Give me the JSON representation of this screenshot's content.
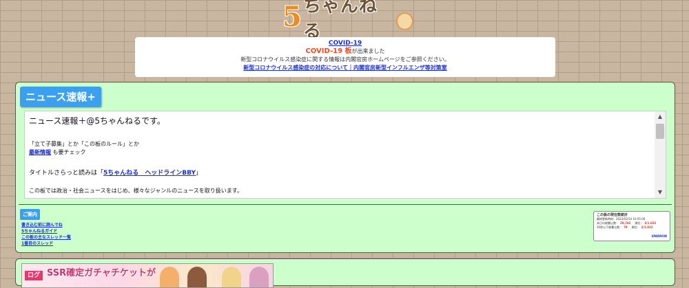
{
  "site": {
    "logo_five": "5",
    "logo_text": "ちゃんねる"
  },
  "notice": {
    "title_link": "COVID-19",
    "head_board": "COVID-19 板",
    "head_suffix": "が出来ました",
    "description": "新型コロナウイルス感染症に関する情報は内閣官房ホームページをご参照ください。",
    "link": "新型コロナウイルス感染症の対応について｜内閣官房新型インフルエンザ等対策室"
  },
  "board": {
    "title": "ニュース速報+",
    "desc_heading": "ニュース速報＋@5ちゃんねるです。",
    "desc_line1": "「立て子募集」とか「この板のルール」とか",
    "desc_link_latest": "最新情報",
    "desc_line2_suffix": "も要チェック",
    "desc_headline_prefix": "タイトルさらっと読みは「",
    "desc_headline_link": "5ちゃんねる　ヘッドラインBBY",
    "desc_headline_suffix": "」",
    "desc_line4": "この板では政治・社会ニュースをはじめ、様々なジャンルのニュースを取り扱います。"
  },
  "guide": {
    "label": "ご案内",
    "links": [
      "書き込む前に読んでね",
      "5ちゃんねるガイド",
      "この板の主なスレッド一覧",
      "1番目のスレッド"
    ]
  },
  "stats": {
    "title": "この板の現在数統計",
    "updated": "最終更新時刻：2023/03/14 10:05:00",
    "row1_label": "本日の総書込数：",
    "row1_value": "29,742",
    "row1_label2": "順位：",
    "row1_value2": "3/1,032",
    "row2_label": "30秒以下総書込数：",
    "row2_value": "79",
    "row2_label2": "順位：",
    "row2_value2": "2/1,032",
    "link": "SPARROW"
  },
  "ad": {
    "tag": "ログ",
    "text": "SSR確定ガチャチケットが"
  },
  "colors": {
    "board_bg": "#ccffcc",
    "title_bg": "#3ca0f0",
    "link": "#1a2fd6",
    "alert": "#e84a22"
  }
}
